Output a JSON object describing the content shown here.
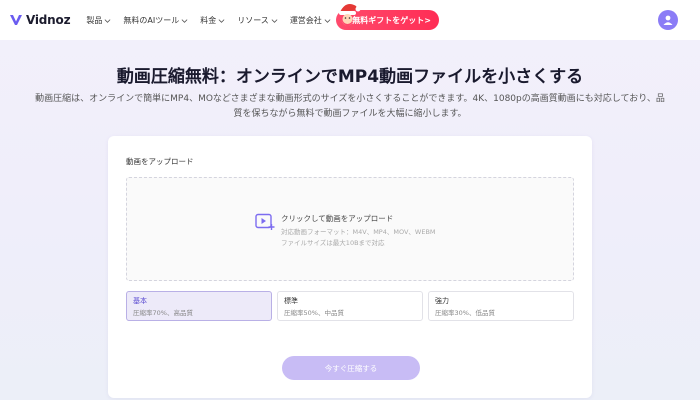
{
  "nav": {
    "brand": "Vidnoz",
    "menu": [
      {
        "label": "製品"
      },
      {
        "label": "無料のAIツール"
      },
      {
        "label": "料金"
      },
      {
        "label": "リソース"
      },
      {
        "label": "運営会社"
      }
    ],
    "promo_label": "無料ギフトをゲット>"
  },
  "hero": {
    "title": "動画圧縮無料：オンラインでMP4動画ファイルを小さくする",
    "subtitle_line1": "動画圧縮は、オンラインで簡単にMP4、MOなどさまざまな動画形式のサイズを小さくすることができます。4K、1080pの高画質動画にも対応しており、品",
    "subtitle_line2": "質を保ちながら無料で動画ファイルを大幅に縮小します。"
  },
  "upload": {
    "label": "動画をアップロード",
    "dropzone_main": "クリックして動画をアップロード",
    "dropzone_formats": "対応動画フォーマット：M4V、MP4、MOV、WEBM",
    "dropzone_size": "ファイルサイズは最大10Bまで対応"
  },
  "options": [
    {
      "name": "基本",
      "desc": "圧縮率70%、高品質",
      "selected": true
    },
    {
      "name": "標準",
      "desc": "圧縮率50%、中品質",
      "selected": false
    },
    {
      "name": "強力",
      "desc": "圧縮率30%、低品質",
      "selected": false
    }
  ],
  "compress_button": "今すぐ圧縮する",
  "colors": {
    "accent": "#8b7cf6",
    "button": "#c8bcf5",
    "promo": "#ff2d55"
  }
}
